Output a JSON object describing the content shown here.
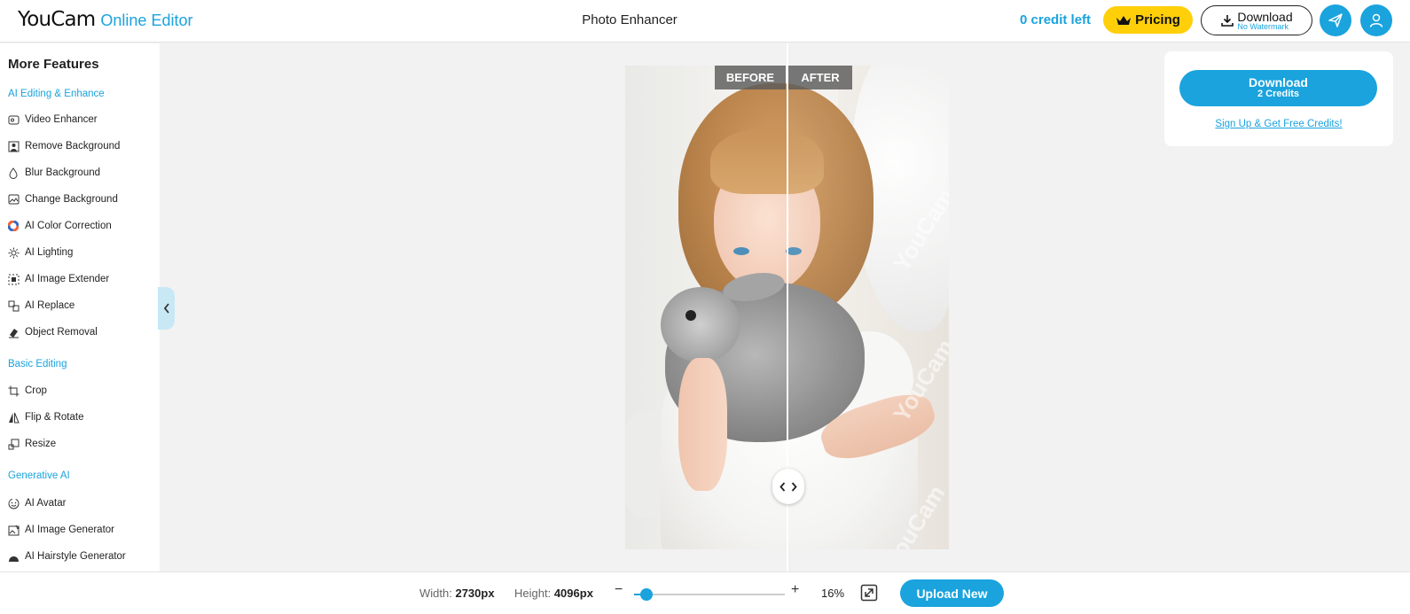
{
  "header": {
    "logo_main": "YouCam",
    "logo_sub": "Online Editor",
    "title": "Photo Enhancer",
    "credits": "0 credit left",
    "pricing_label": "Pricing",
    "download_label": "Download",
    "download_sub": "No Watermark"
  },
  "sidebar": {
    "heading": "More Features",
    "sections": [
      {
        "title": "AI Editing & Enhance",
        "items": [
          {
            "label": "Video Enhancer",
            "icon": "video-enhance-icon"
          },
          {
            "label": "Remove Background",
            "icon": "remove-bg-icon"
          },
          {
            "label": "Blur Background",
            "icon": "drop-icon"
          },
          {
            "label": "Change Background",
            "icon": "image-icon"
          },
          {
            "label": "AI Color Correction",
            "icon": "color-wheel-icon"
          },
          {
            "label": "AI Lighting",
            "icon": "sun-icon"
          },
          {
            "label": "AI Image Extender",
            "icon": "extend-icon"
          },
          {
            "label": "AI Replace",
            "icon": "replace-icon"
          },
          {
            "label": "Object Removal",
            "icon": "eraser-icon"
          }
        ]
      },
      {
        "title": "Basic Editing",
        "items": [
          {
            "label": "Crop",
            "icon": "crop-icon"
          },
          {
            "label": "Flip & Rotate",
            "icon": "flip-icon"
          },
          {
            "label": "Resize",
            "icon": "resize-icon"
          }
        ]
      },
      {
        "title": "Generative AI",
        "items": [
          {
            "label": "AI Avatar",
            "icon": "smile-icon"
          },
          {
            "label": "AI Image Generator",
            "icon": "image-gen-icon"
          },
          {
            "label": "AI Hairstyle Generator",
            "icon": "hair-icon"
          }
        ]
      }
    ]
  },
  "compare": {
    "before_label": "BEFORE",
    "after_label": "AFTER",
    "watermark": "YouCam"
  },
  "download_panel": {
    "button_label": "Download",
    "button_sub": "2 Credits",
    "signup_link": "Sign Up & Get Free Credits!"
  },
  "bottom": {
    "width_label": "Width:",
    "width_value": "2730px",
    "height_label": "Height:",
    "height_value": "4096px",
    "zoom_percent": "16%",
    "zoom_level": 0.16,
    "upload_label": "Upload New"
  },
  "colors": {
    "accent": "#1aa3dd",
    "pricing": "#ffcf0a"
  }
}
